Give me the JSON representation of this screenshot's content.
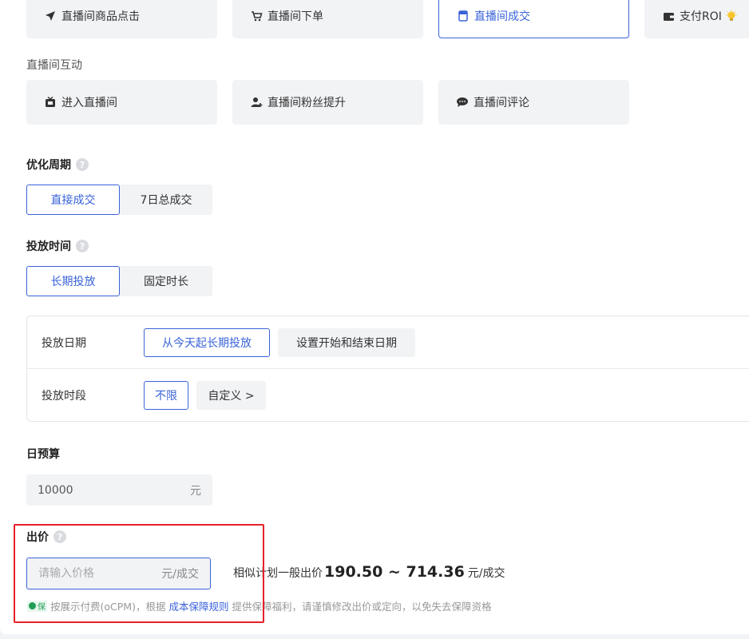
{
  "top_goals": [
    {
      "label": "直播间商品点击",
      "icon": "send-icon"
    },
    {
      "label": "直播间下单",
      "icon": "cart-icon"
    },
    {
      "label": "直播间成交",
      "icon": "doc-icon"
    },
    {
      "label": "支付ROI",
      "icon": "wallet-icon"
    }
  ],
  "interaction_section": {
    "label": "直播间互动",
    "goals": [
      {
        "label": "进入直播间",
        "icon": "tv-icon"
      },
      {
        "label": "直播间粉丝提升",
        "icon": "fan-icon"
      },
      {
        "label": "直播间评论",
        "icon": "comment-icon"
      }
    ]
  },
  "optimize_cycle": {
    "title": "优化周期",
    "options": [
      "直接成交",
      "7日总成交"
    ],
    "selected": "直接成交"
  },
  "delivery_time": {
    "title": "投放时间",
    "options": [
      "长期投放",
      "固定时长"
    ],
    "selected": "长期投放",
    "date_row": {
      "label": "投放日期",
      "options": [
        "从今天起长期投放",
        "设置开始和结束日期"
      ],
      "selected": "从今天起长期投放"
    },
    "period_row": {
      "label": "投放时段",
      "options": [
        "不限",
        "自定义 >"
      ],
      "selected": "不限"
    }
  },
  "daily_budget": {
    "title": "日预算",
    "value": "10000",
    "unit": "元"
  },
  "bid": {
    "title": "出价",
    "placeholder": "请输入价格",
    "unit": "元/成交",
    "ref_prefix": "相似计划一般出价",
    "ref_range": "190.50 ~ 714.36",
    "ref_unit": "元/成交",
    "guarantee_badge": "保",
    "guarantee_text_1": "按展示付费(oCPM)，根据",
    "guarantee_link": "成本保障规则",
    "guarantee_text_2": "提供保障福利，请谨慎修改出价或定向，以免失去保障资格"
  },
  "colors": {
    "accent": "#3a63d9",
    "highlight_box": "#e5212a",
    "guarantee_green": "#1f9d55"
  }
}
